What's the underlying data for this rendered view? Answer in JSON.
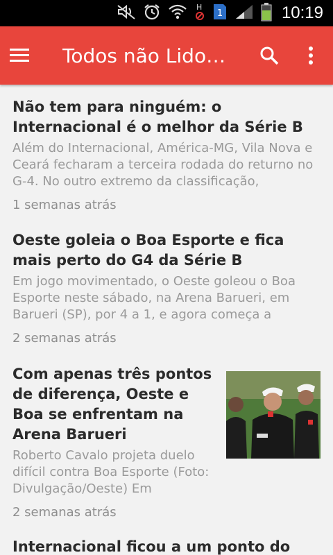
{
  "status_bar": {
    "time": "10:19",
    "icons": [
      "mute-icon",
      "alarm-icon",
      "wifi-icon",
      "hsdpa-icon",
      "sim-1-icon",
      "signal-icon",
      "battery-icon"
    ],
    "sim_label": "1"
  },
  "app_bar": {
    "title": "Todos não Lidos...",
    "background": "#e8453c",
    "icons": [
      "menu-icon",
      "search-icon",
      "overflow-menu-icon"
    ]
  },
  "articles": [
    {
      "title": "Não tem para ninguém: o Internacional é o melhor da Série B",
      "summary": "Além do Internacional, América-MG, Vila Nova e Ceará fecharam a terceira rodada do returno no G-4. No outro extremo da classificação,",
      "time": "1 semanas atrás"
    },
    {
      "title": "Oeste goleia o Boa Esporte e fica mais perto do G4 da Série B",
      "summary": "Em jogo movimentado, o Oeste goleou o Boa Esporte neste sábado, na Arena Barueri, em Barueri (SP), por 4 a 1, e agora começa a",
      "time": "2 semanas atrás"
    },
    {
      "title": "Com apenas três pontos de diferença, Oeste e Boa se enfrentam na Arena Barueri",
      "summary": "Roberto Cavalo projeta duelo difícil contra Boa Esporte (Foto: Divulgação/Oeste) Em",
      "time": "2 semanas atrás",
      "thumbnail": "coach-and-players-photo"
    },
    {
      "title": "Internacional ficou a um ponto do líder",
      "summary": "",
      "time": ""
    }
  ]
}
